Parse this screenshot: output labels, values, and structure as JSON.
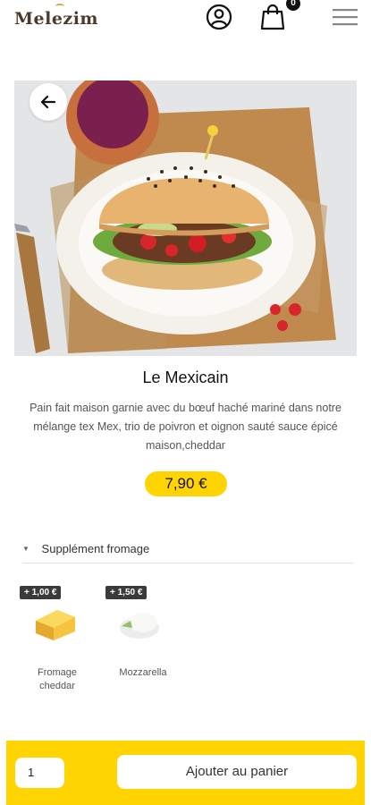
{
  "header": {
    "logo_text": "Melezim",
    "cart_count": "0",
    "icons": {
      "user": "user-icon",
      "cart": "shopping-bag-icon",
      "menu": "hamburger-menu-icon"
    }
  },
  "product": {
    "title": "Le Mexicain",
    "description": "Pain fait maison garnie avec du bœuf haché mariné dans notre mélange tex Mex, trio de poivron et oignon sauté sauce épicé maison,cheddar",
    "price": "7,90 €",
    "image": "burger-photo"
  },
  "supplements": {
    "title": "Supplément fromage",
    "options": [
      {
        "price": "+ 1,00 €",
        "label": "Fromage cheddar",
        "icon": "cheddar-cheese-icon"
      },
      {
        "price": "+ 1,50 €",
        "label": "Mozzarella",
        "icon": "mozzarella-icon"
      }
    ]
  },
  "cart_bar": {
    "quantity": "1",
    "add_label": "Ajouter au panier"
  },
  "colors": {
    "accent": "#ffd400",
    "badge": "#3a3a3a"
  }
}
